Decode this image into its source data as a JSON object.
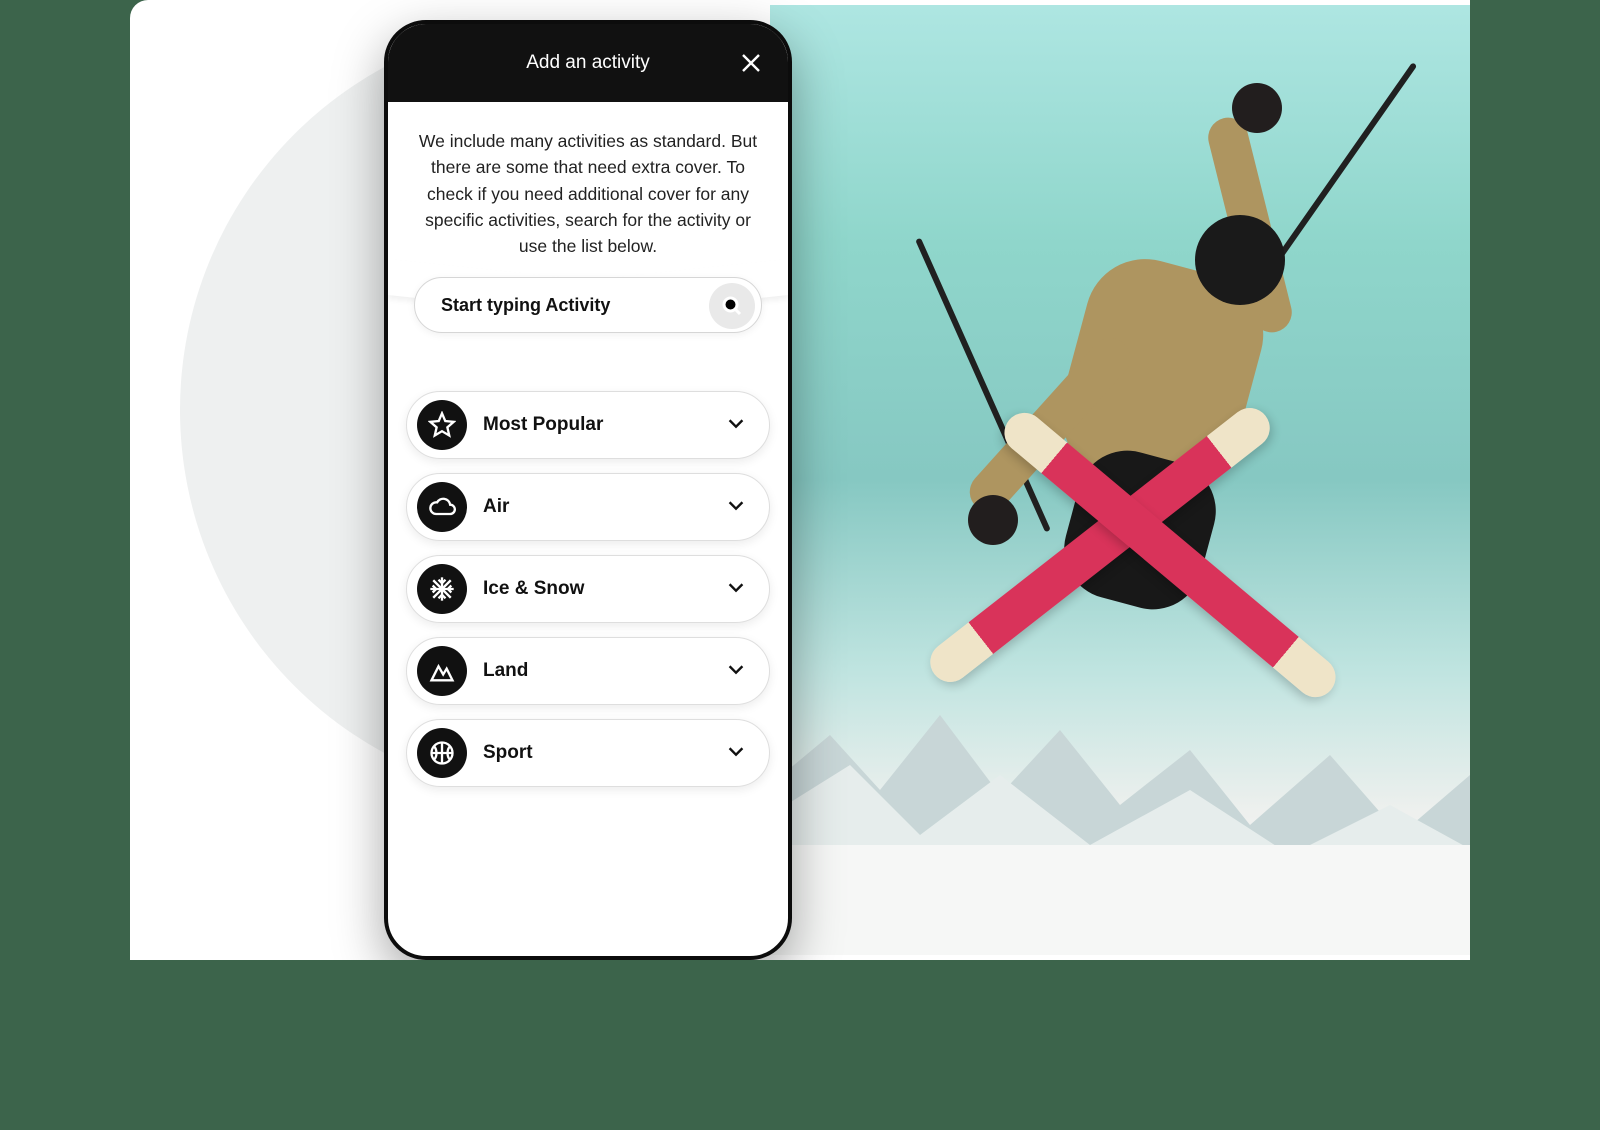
{
  "modal": {
    "title": "Add an activity",
    "intro": "We include many activities as standard. But there are some that need extra cover. To check if you need additional cover for any specific activities, search for the activity or use the list below.",
    "search_placeholder": "Start typing Activity"
  },
  "categories": [
    {
      "icon": "star",
      "label": "Most Popular"
    },
    {
      "icon": "cloud",
      "label": "Air"
    },
    {
      "icon": "snowflake",
      "label": "Ice & Snow"
    },
    {
      "icon": "mountain",
      "label": "Land"
    },
    {
      "icon": "ball",
      "label": "Sport"
    }
  ]
}
